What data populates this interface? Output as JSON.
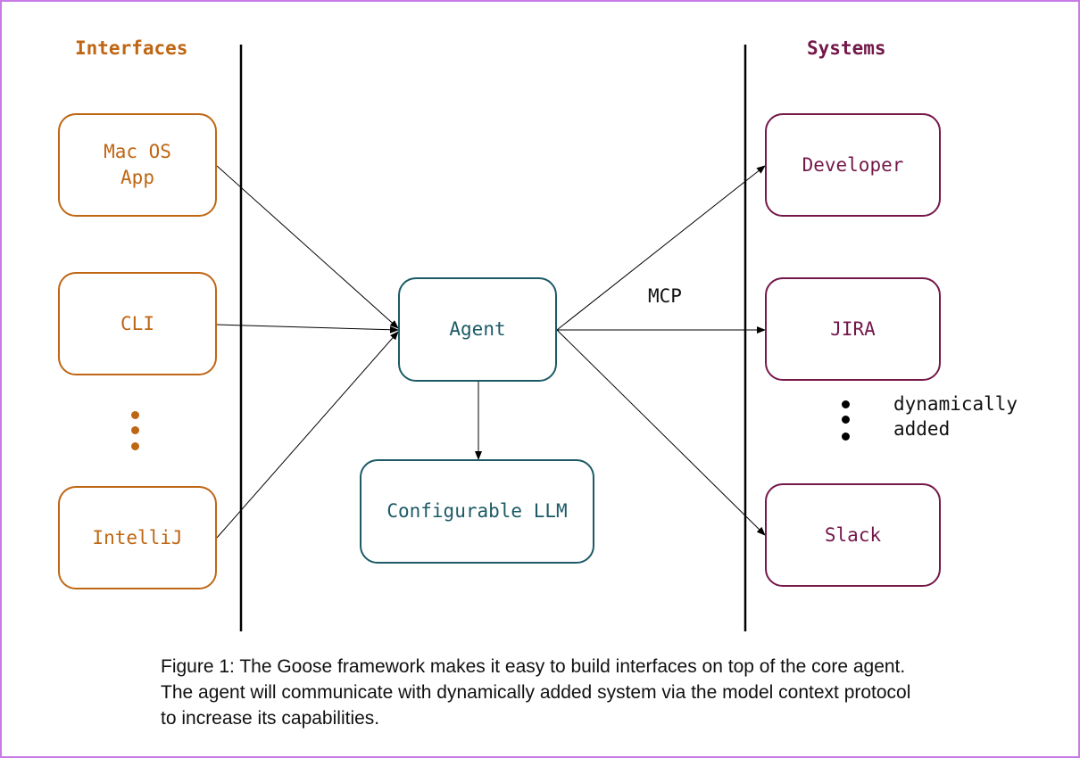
{
  "headings": {
    "interfaces": "Interfaces",
    "systems": "Systems"
  },
  "interfaces": [
    {
      "id": "macos",
      "label": "Mac OS App"
    },
    {
      "id": "cli",
      "label": "CLI"
    },
    {
      "id": "intellij",
      "label": "IntelliJ"
    }
  ],
  "core": {
    "agent": "Agent",
    "llm": "Configurable LLM"
  },
  "systems": [
    {
      "id": "developer",
      "label": "Developer"
    },
    {
      "id": "jira",
      "label": "JIRA"
    },
    {
      "id": "slack",
      "label": "Slack"
    }
  ],
  "labels": {
    "mcp": "MCP",
    "dynamic_line1": "dynamically",
    "dynamic_line2": "added"
  },
  "colors": {
    "interfaces": "#bf6613",
    "systems": "#74184a",
    "core": "#1b5a66",
    "frame": "#c97ae6"
  },
  "caption": "Figure 1: The Goose framework makes it easy to build interfaces on top of the core agent. The agent will communicate with dynamically added system via the model context protocol to increase its capabilities."
}
